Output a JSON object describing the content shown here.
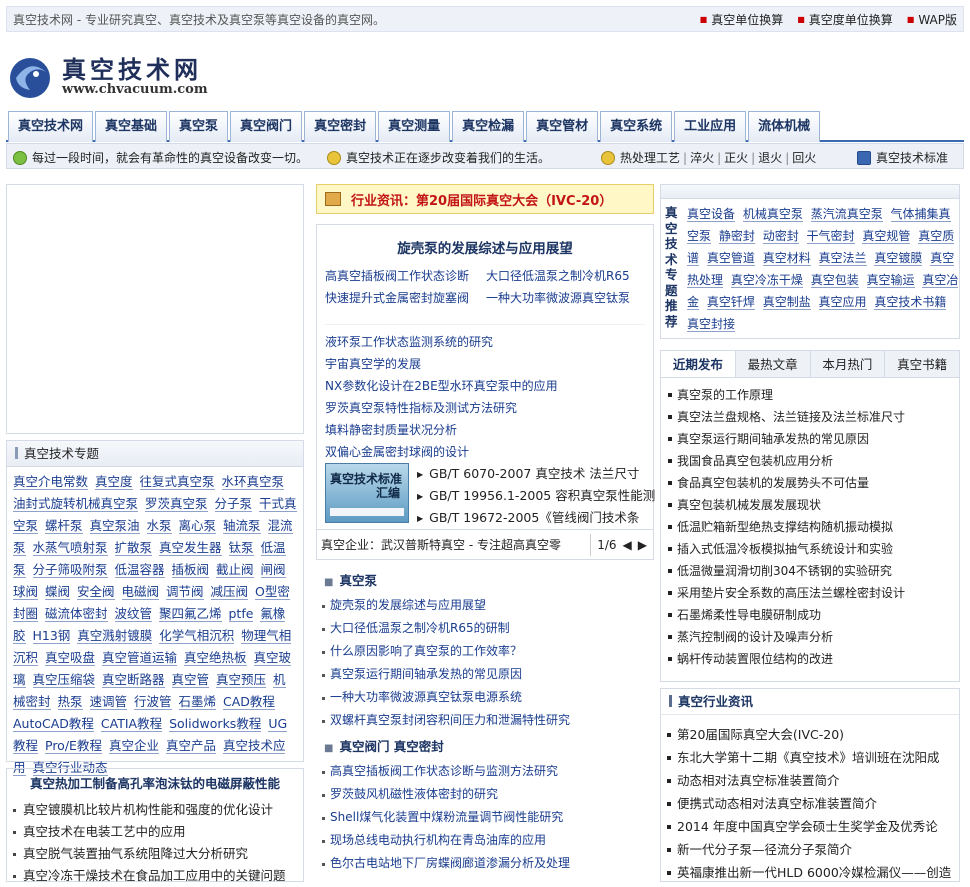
{
  "topbar": {
    "slogan": "真空技术网 - 专业研究真空、真空技术及真空泵等真空设备的真空网。",
    "links": [
      "真空单位换算",
      "真空度单位换算",
      "WAP版"
    ]
  },
  "logo": {
    "cn": "真空技术网",
    "en": "www.chvacuum.com"
  },
  "nav": [
    "真空技术网",
    "真空基础",
    "真空泵",
    "真空阀门",
    "真空密封",
    "真空测量",
    "真空检漏",
    "真空管材",
    "真空系统",
    "工业应用",
    "流体机械"
  ],
  "infobar": {
    "msg1": "每过一段时间，就会有革命性的真空设备改变一切。",
    "msg2": "真空技术正在逐步改变着我们的生活。",
    "heat": [
      "热处理工艺",
      "淬火",
      "正火",
      "退火",
      "回火"
    ],
    "standard": "真空技术标准"
  },
  "left": {
    "topics_title": "真空技术专题",
    "topics": [
      "真空介电常数",
      "真空度",
      "往复式真空泵",
      "水环真空泵",
      "油封式旋转机械真空泵",
      "罗茨真空泵",
      "分子泵",
      "干式真空泵",
      "螺杆泵",
      "真空泵油",
      "水泵",
      "离心泵",
      "轴流泵",
      "混流泵",
      "水蒸气喷射泵",
      "扩散泵",
      "真空发生器",
      "钛泵",
      "低温泵",
      "分子筛吸附泵",
      "低温容器",
      "插板阀",
      "截止阀",
      "闸阀",
      "球阀",
      "蝶阀",
      "安全阀",
      "电磁阀",
      "调节阀",
      "减压阀",
      "O型密封圈",
      "磁流体密封",
      "波纹管",
      "聚四氟乙烯",
      "ptfe",
      "氟橡胶",
      "H13钢",
      "真空溅射镀膜",
      "化学气相沉积",
      "物理气相沉积",
      "真空吸盘",
      "真空管道运输",
      "真空绝热板",
      "真空玻璃",
      "真空压缩袋",
      "真空断路器",
      "真空管",
      "真空预压",
      "机械密封",
      "热泵",
      "速调管",
      "行波管",
      "石墨烯",
      "CAD教程",
      "AutoCAD教程",
      "CATIA教程",
      "Solidworks教程",
      "UG教程",
      "Pro/E教程",
      "真空企业",
      "真空产品",
      "真空技术应用",
      "真空行业动态"
    ],
    "bottom_title": "真空热加工制备高孔率泡沫钛的电磁屏蔽性能",
    "bottom_items": [
      "真空镀膜机比较片机构性能和强度的优化设计",
      "真空技术在电装工艺中的应用",
      "真空脱气装置抽气系统阻降过大分析研究",
      "真空冷冻干燥技术在食品加工应用中的关键问题"
    ]
  },
  "news": "行业资讯：第20届国际真空大会（IVC-20）",
  "mid": {
    "headline": "旋壳泵的发展综述与应用展望",
    "pairs": [
      [
        "高真空插板阀工作状态诊断",
        "大口径低温泵之制冷机R65"
      ],
      [
        "快速提升式金属密封旋塞阀",
        "一种大功率微波源真空钛泵"
      ]
    ],
    "singles": [
      "液环泵工作状态监测系统的研究",
      "宇宙真空学的发展",
      "NX参数化设计在2BE型水环真空泵中的应用",
      "罗茨真空泵特性指标及测试方法研究",
      "填料静密封质量状况分析",
      "双偏心金属密封球阀的设计"
    ],
    "book_t1": "真空技术标准",
    "book_t2": "汇编",
    "gb": [
      "GB/T 6070-2007 真空技术 法兰尺寸",
      "GB/T 19956.1-2005 容积真空泵性能测",
      "GB/T 19672-2005《管线阀门技术条"
    ],
    "enterprise": "真空企业：武汉普斯特真空 - 专注超高真空零",
    "pager": "1/6"
  },
  "sections": [
    {
      "title": "真空泵",
      "items": [
        "旋壳泵的发展综述与应用展望",
        "大口径低温泵之制冷机R65的研制",
        "什么原因影响了真空泵的工作效率？",
        "真空泵运行期间轴承发热的常见原因",
        "一种大功率微波源真空钛泵电源系统",
        "双螺杆真空泵封闭容积间压力和泄漏特性研究"
      ]
    },
    {
      "title": "真空阀门 真空密封",
      "items": [
        "高真空插板阀工作状态诊断与监测方法研究",
        "罗茨鼓风机磁性液体密封的研究",
        "Shell煤气化装置中煤粉流量调节阀性能研究",
        "现场总线电动执行机构在青岛油库的应用",
        "色尔古电站地下厂房蝶阀廊道渗漏分析及处理"
      ]
    }
  ],
  "right": {
    "topic_title": "真空技术专题推荐",
    "topic_tags": [
      "真空设备",
      "机械真空泵",
      "蒸汽流真空泵",
      "气体捕集真空泵",
      "静密封",
      "动密封",
      "干气密封",
      "真空规管",
      "真空质谱",
      "真空管道",
      "真空材料",
      "真空法兰",
      "真空镀膜",
      "真空热处理",
      "真空冷冻干燥",
      "真空包装",
      "真空输运",
      "真空冶金",
      "真空钎焊",
      "真空制盐",
      "真空应用",
      "真空技术书籍",
      "真空封接"
    ],
    "tabs": [
      "近期发布",
      "最热文章",
      "本月热门",
      "真空书籍"
    ],
    "recent": [
      "真空泵的工作原理",
      "真空法兰盘规格、法兰链接及法兰标准尺寸",
      "真空泵运行期间轴承发热的常见原因",
      "我国食品真空包装机应用分析",
      "食品真空包装机的发展势头不可估量",
      "真空包装机械发展发展现状",
      "低温贮箱新型绝热支撑结构随机振动模拟",
      "插入式低温冷板模拟抽气系统设计和实验",
      "低温微量润滑切削304不锈钢的实验研究",
      "采用垫片安全系数的高压法兰螺栓密封设计",
      "石墨烯柔性导电膜研制成功",
      "蒸汽控制阀的设计及噪声分析",
      "蜗杆传动装置限位结构的改进"
    ],
    "industry_title": "真空行业资讯",
    "industry": [
      "第20届国际真空大会(IVC-20)",
      "东北大学第十二期《真空技术》培训班在沈阳成",
      "动态相对法真空标准装置简介",
      "便携式动态相对法真空标准装置简介",
      "2014 年度中国真空学会硕士生奖学金及优秀论",
      "新一代分子泵—径流分子泵简介",
      "英福康推出新一代HLD 6000冷媒检漏仪——创造"
    ]
  },
  "colors": {
    "nav_border": "#3c6ab0",
    "news_text": "#c21414",
    "link": "#1a3d8f"
  }
}
